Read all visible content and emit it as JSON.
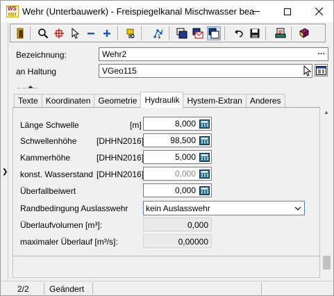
{
  "window": {
    "title": "Wehr (Unterbauwerk) - Freispiegelkanal Mischwasser bea...",
    "app_icon_text": "WS"
  },
  "toolbar": {
    "icons": [
      "exit-door-icon",
      "zoom-icon",
      "crosshair-icon",
      "pointer-icon",
      "minus-icon",
      "plus-icon",
      "object-properties-icon",
      "network-icon",
      "window-layer-front-icon",
      "window-layer-envelope-icon",
      "window-layer-active-icon",
      "undo-icon",
      "save-icon",
      "print-list-icon",
      "book-icon"
    ]
  },
  "header": {
    "bezeichnung_label": "Bezeichnung:",
    "bezeichnung_value": "Wehr2",
    "haltung_label": "an Haltung",
    "haltung_value": "VGeo115"
  },
  "tabs": [
    "Texte",
    "Koordinaten",
    "Geometrie",
    "Hydraulik",
    "Hystem-Extran",
    "Anderes"
  ],
  "active_tab": "Hydraulik",
  "fields": {
    "laenge_schwelle": {
      "label": "Länge Schwelle",
      "unit": "[m]",
      "value": "8,000"
    },
    "schwellenhoehe": {
      "label": "Schwellenhöhe",
      "unit": "[DHHN2016]",
      "value": "98,500"
    },
    "kammerhoehe": {
      "label": "Kammerhöhe",
      "unit": "[DHHN2016]",
      "value": "5,000"
    },
    "wasserstand": {
      "label": "konst. Wasserstand",
      "unit": "[DHHN2016]",
      "value": "0,000"
    },
    "ueberfallbeiwert": {
      "label": "Überfallbeiwert",
      "value": "0,000"
    },
    "randbedingung": {
      "label": "Randbedingung Auslasswehr",
      "value": "kein Auslasswehr"
    },
    "ueberlaufvolumen": {
      "label": "Überlaufvolumen [m³]:",
      "value": "0,000"
    },
    "max_ueberlauf": {
      "label": "maximaler Überlauf [m³/s]:",
      "value": "0,00000"
    }
  },
  "status": {
    "record": "2/2",
    "state": "Geändert"
  },
  "colors": {
    "accent_blue": "#1a5fb4",
    "calc_icon": "#2a6b8a",
    "titlebar": "#ffffff",
    "surface": "#f0f0f0"
  }
}
